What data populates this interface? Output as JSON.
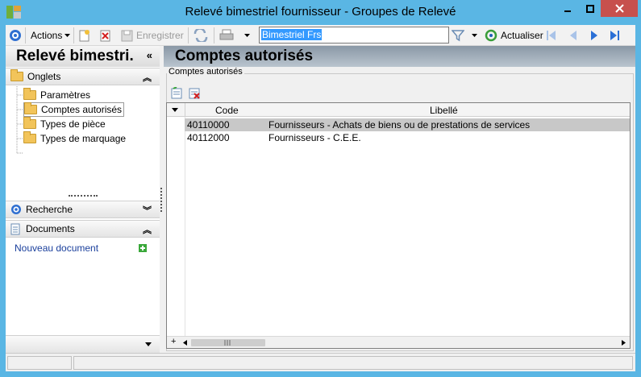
{
  "window": {
    "title": "Relevé bimestriel fournisseur -  Groupes de Relevé"
  },
  "toolbar": {
    "actions_label": "Actions",
    "save_label": "Enregistrer",
    "record_value": "Bimestriel Frs",
    "refresh_label": "Actualiser"
  },
  "left": {
    "header": "Relevé bimestri.",
    "tabs_section": "Onglets",
    "tabs": [
      "Paramètres",
      "Comptes autorisés",
      "Types de pièce",
      "Types de marquage"
    ],
    "search_section": "Recherche",
    "documents_section": "Documents",
    "new_document": "Nouveau document"
  },
  "main": {
    "header": "Comptes autorisés",
    "group_label": "Comptes autorisés",
    "columns": [
      "Code",
      "Libellé"
    ],
    "rows": [
      {
        "code": "40110000",
        "label": "Fournisseurs - Achats de biens ou de prestations de services"
      },
      {
        "code": "40112000",
        "label": "Fournisseurs - C.E.E."
      }
    ]
  },
  "colors": {
    "title_bar": "#5ab6e4",
    "close_button": "#c7504d",
    "selection": "#3399ff",
    "link": "#1a3f9c"
  }
}
